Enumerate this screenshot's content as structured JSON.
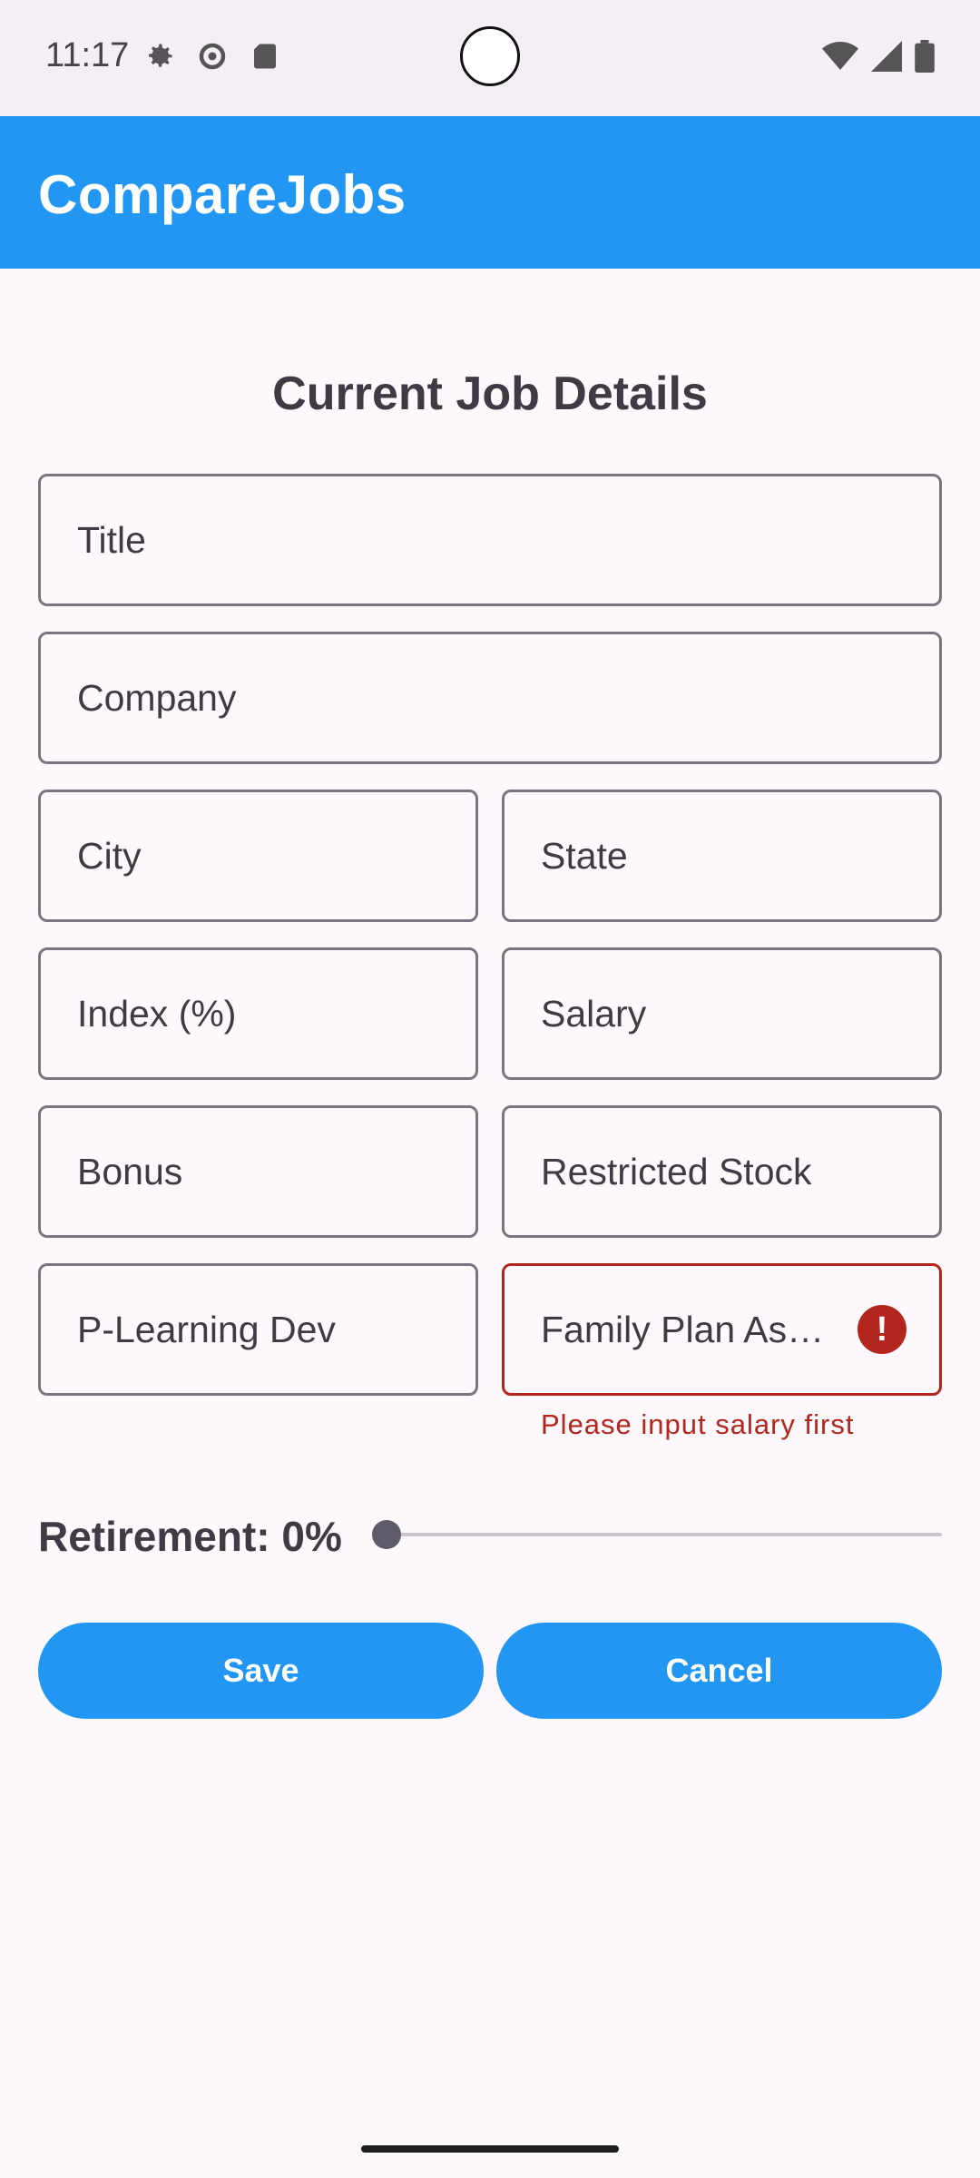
{
  "status_bar": {
    "time": "11:17",
    "left_icons": [
      "settings-gear-icon",
      "settings-icon",
      "sd-card-icon"
    ],
    "right_icons": [
      "wifi-icon",
      "cell-signal-icon",
      "battery-icon"
    ]
  },
  "app_bar": {
    "title": "CompareJobs"
  },
  "form": {
    "heading": "Current Job Details",
    "fields": {
      "title": "Title",
      "company": "Company",
      "city": "City",
      "state": "State",
      "index": "Index (%)",
      "salary": "Salary",
      "bonus": "Bonus",
      "restricted_stock": "Restricted Stock",
      "learning_dev": "P-Learning Dev",
      "family_plan": "Family Plan As…"
    },
    "error_message": "Please input salary first",
    "error_icon": "!",
    "retirement": {
      "label": "Retirement: 0%",
      "value": 0
    }
  },
  "buttons": {
    "save": "Save",
    "cancel": "Cancel"
  },
  "colors": {
    "accent": "#2196f3",
    "error": "#b3261e"
  }
}
